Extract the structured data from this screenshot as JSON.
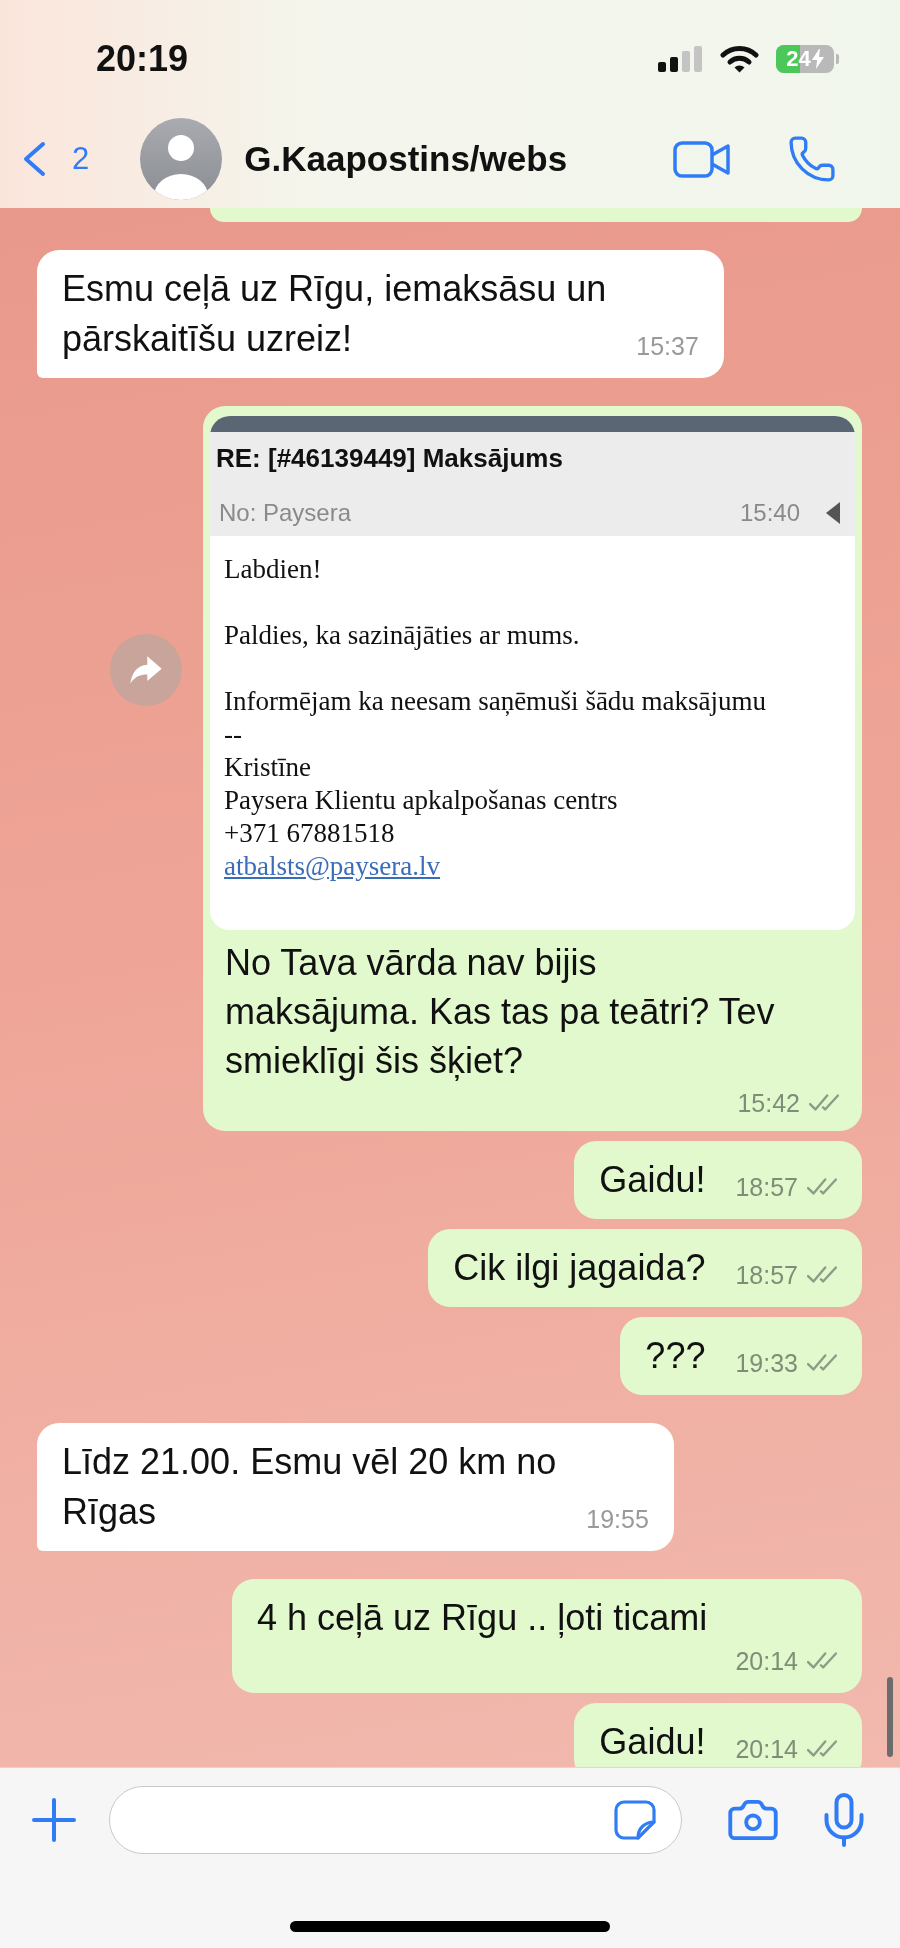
{
  "status_bar": {
    "time": "20:19",
    "battery": "24",
    "charging": true
  },
  "header": {
    "back_count": "2",
    "contact_name": "G.Kaapostins/webs"
  },
  "messages": [
    {
      "kind": "clipped",
      "outgoing": true
    },
    {
      "kind": "text",
      "outgoing": false,
      "text": "Esmu ceļā uz Rīgu, iemaksāsu un\npārskaitīšu uzreiz!",
      "time": "15:37"
    },
    {
      "kind": "email",
      "outgoing": true,
      "email": {
        "subject": "RE: [#46139449] Maksājums",
        "sender": "No: Paysera",
        "time": "15:40",
        "paragraphs": [
          "Labdien!",
          "Paldies, ka sazinājāties ar mums.",
          "Informējam ka neesam saņēmuši šādu maksājumu"
        ],
        "signature": [
          "--",
          "Kristīne",
          "Paysera Klientu apkalpošanas centrs",
          "+371 67881518"
        ],
        "link": "atbalsts@paysera.lv"
      },
      "text": "No Tava vārda nav bijis\nmaksājuma. Kas tas pa teātri? Tev\nsmieklīgi šis šķiet?",
      "time": "15:42",
      "read": false
    },
    {
      "kind": "text",
      "outgoing": true,
      "text": "Gaidu!",
      "time": "18:57",
      "read": false
    },
    {
      "kind": "text",
      "outgoing": true,
      "text": "Cik ilgi jagaida?",
      "time": "18:57",
      "read": false
    },
    {
      "kind": "text",
      "outgoing": true,
      "text": "???",
      "time": "19:33",
      "read": false
    },
    {
      "kind": "text",
      "outgoing": false,
      "text": "Līdz 21.00. Esmu vēl 20 km no\nRīgas",
      "time": "19:55"
    },
    {
      "kind": "text",
      "outgoing": true,
      "text": "4 h ceļā uz Rīgu .. ļoti ticami",
      "time": "20:14",
      "read": false
    },
    {
      "kind": "text",
      "outgoing": true,
      "text": "Gaidu!",
      "time": "20:14",
      "read": false
    }
  ]
}
